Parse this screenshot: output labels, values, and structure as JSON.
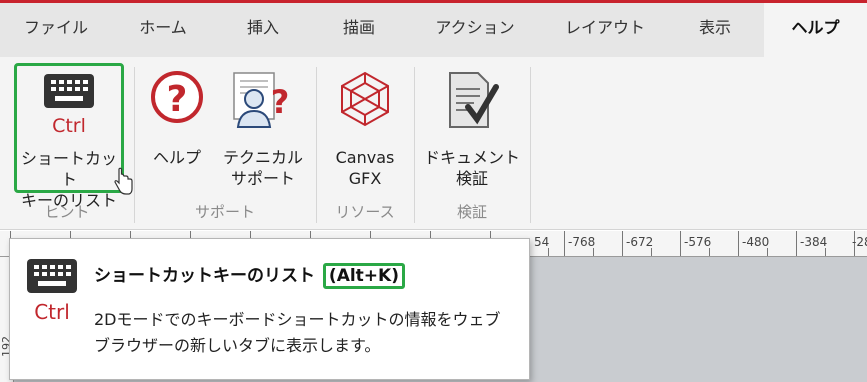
{
  "tabs": [
    {
      "label": "ファイル",
      "active": false
    },
    {
      "label": "ホーム",
      "active": false
    },
    {
      "label": "挿入",
      "active": false
    },
    {
      "label": "描画",
      "active": false
    },
    {
      "label": "アクション",
      "active": false
    },
    {
      "label": "レイアウト",
      "active": false
    },
    {
      "label": "表示",
      "active": false
    },
    {
      "label": "ヘルプ",
      "active": true
    }
  ],
  "ribbon": {
    "shortcut_list": {
      "label": "ショートカット\nキーのリスト",
      "icon": "keyboard-ctrl-icon",
      "icon_text": "Ctrl"
    },
    "help": {
      "label": "ヘルプ",
      "icon": "question-mark-icon"
    },
    "tech_support": {
      "label": "テクニカル\nサポート",
      "icon": "support-person-icon"
    },
    "canvas_gfx": {
      "label": "Canvas\nGFX",
      "icon": "canvas-gfx-logo-icon"
    },
    "doc_verify": {
      "label": "ドキュメント\n検証",
      "icon": "document-check-icon"
    },
    "groups": {
      "hint": "ヒント",
      "support": "サポート",
      "resources": "リソース",
      "verify": "検証"
    }
  },
  "ruler": {
    "labels": [
      "54",
      "-768",
      "-672",
      "-576",
      "-480",
      "-384",
      "-28"
    ]
  },
  "vruler": {
    "label": "192"
  },
  "tooltip": {
    "title": "ショートカットキーのリスト",
    "shortcut": "(Alt+K)",
    "description": "2Dモードでのキーボードショートカットの情報をウェブブラウザーの新しいタブに表示します。",
    "icon": "keyboard-ctrl-icon",
    "icon_text": "Ctrl"
  },
  "colors": {
    "accent_red": "#c8232d",
    "highlight_green": "#2aa845",
    "help_red": "#c1272d"
  }
}
